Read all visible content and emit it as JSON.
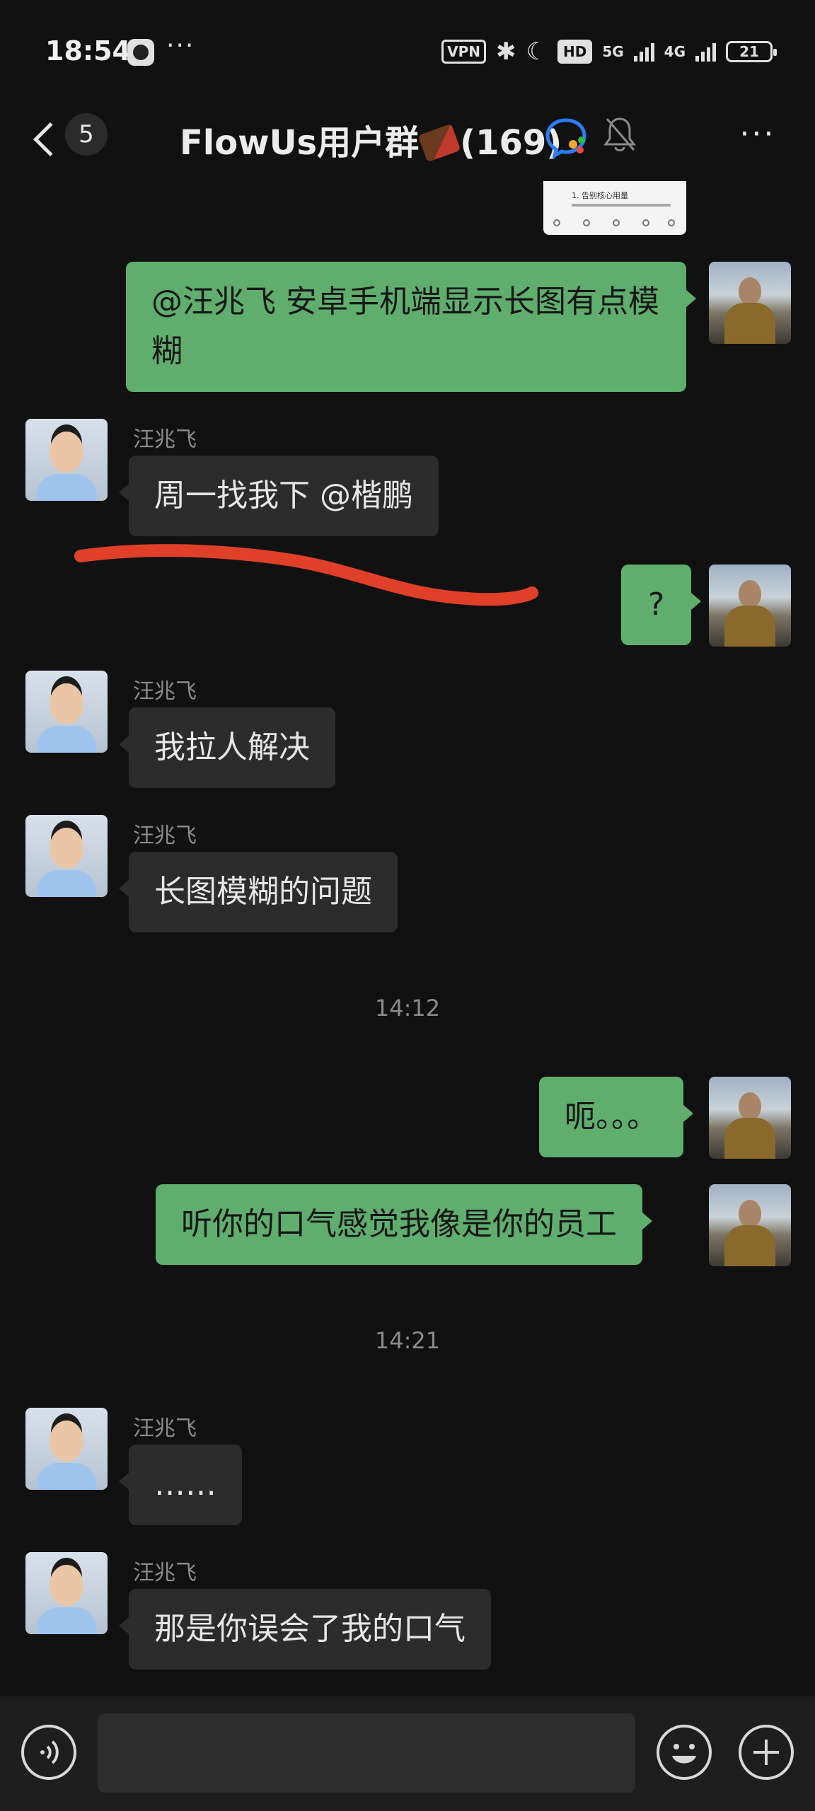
{
  "status_bar": {
    "time": "18:54",
    "more": "···",
    "vpn": "VPN",
    "hd": "HD",
    "net_5g": "5G",
    "net_4g": "4G",
    "battery": "21"
  },
  "header": {
    "unread_count": "5",
    "title_left": "FlowUs用户群",
    "title_right": "(169)",
    "menu": "···"
  },
  "messages": [
    {
      "type": "image",
      "direction": "out",
      "preview_title": "1. 告别核心用量"
    },
    {
      "type": "text",
      "direction": "out",
      "text": "@汪兆飞  安卓手机端显示长图有点模糊"
    },
    {
      "type": "text",
      "direction": "in",
      "sender": "汪兆飞",
      "text": "周一找我下 @楷鹏"
    },
    {
      "type": "text",
      "direction": "out",
      "text": "?"
    },
    {
      "type": "text",
      "direction": "in",
      "sender": "汪兆飞",
      "text": "我拉人解决"
    },
    {
      "type": "text",
      "direction": "in",
      "sender": "汪兆飞",
      "text": "长图模糊的问题"
    },
    {
      "type": "time",
      "text": "14:12"
    },
    {
      "type": "text",
      "direction": "out",
      "text": "呃。。。"
    },
    {
      "type": "text",
      "direction": "out",
      "text": "听你的口气感觉我像是你的员工"
    },
    {
      "type": "time",
      "text": "14:21"
    },
    {
      "type": "text",
      "direction": "in",
      "sender": "汪兆飞",
      "text": "……"
    },
    {
      "type": "text",
      "direction": "in",
      "sender": "汪兆飞",
      "text": "那是你误会了我的口气"
    }
  ],
  "annotation": {
    "color": "#e0402a"
  },
  "colors": {
    "background": "#111111",
    "bubble_out": "#5fae6e",
    "bubble_in": "#2c2c2c"
  },
  "input_bar": {
    "value": ""
  }
}
